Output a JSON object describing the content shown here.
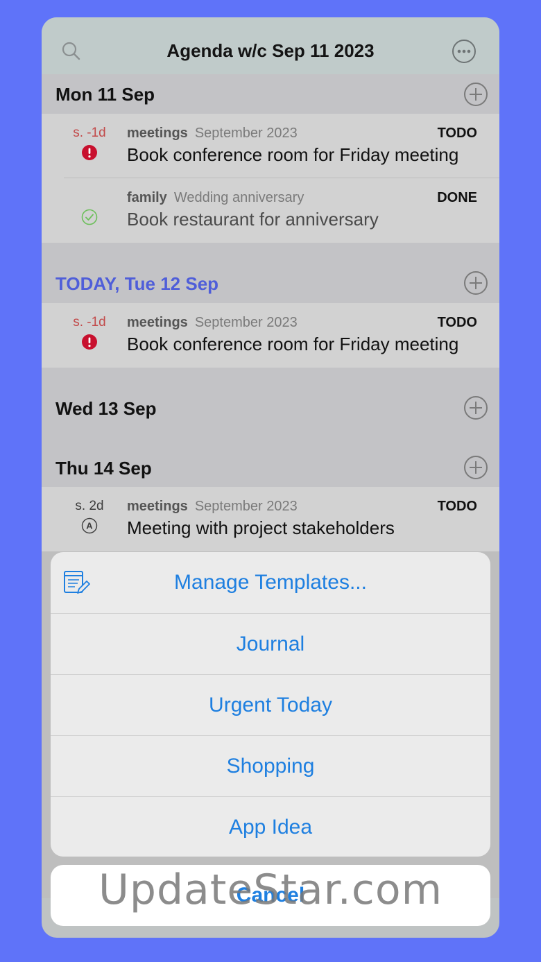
{
  "header": {
    "title": "Agenda w/c Sep 11 2023"
  },
  "sections": [
    {
      "label": "Mon 11 Sep",
      "today": false,
      "items": [
        {
          "sched": "s. -1d",
          "sched_color": "red",
          "icon": "priority-high-icon",
          "tag": "meetings",
          "context": "September 2023",
          "state": "TODO",
          "text": "Book conference room for Friday meeting"
        },
        {
          "sched": "",
          "sched_color": "dark",
          "icon": "done-check-icon",
          "tag": "family",
          "context": "Wedding anniversary",
          "state": "DONE",
          "text": "Book restaurant for anniversary"
        }
      ]
    },
    {
      "label": "TODAY, Tue 12 Sep",
      "today": true,
      "items": [
        {
          "sched": "s. -1d",
          "sched_color": "red",
          "icon": "priority-high-icon",
          "tag": "meetings",
          "context": "September 2023",
          "state": "TODO",
          "text": "Book conference room for Friday meeting"
        }
      ]
    },
    {
      "label": "Wed 13 Sep",
      "today": false,
      "items": []
    },
    {
      "label": "Thu 14 Sep",
      "today": false,
      "items": [
        {
          "sched": "s. 2d",
          "sched_color": "dark",
          "icon": "priority-a-icon",
          "tag": "meetings",
          "context": "September 2023",
          "state": "TODO",
          "text": "Meeting with project stakeholders"
        }
      ]
    }
  ],
  "action_sheet": {
    "options": [
      "Manage Templates...",
      "Journal",
      "Urgent Today",
      "Shopping",
      "App Idea"
    ],
    "cancel_label": "Cancel"
  },
  "watermark": "UpdateStar.com",
  "colors": {
    "accent": "#1e7fe0",
    "today": "#4f5ed9",
    "background": "#5f73f9",
    "priority": "#c8102e",
    "done": "#6cbf5a"
  }
}
